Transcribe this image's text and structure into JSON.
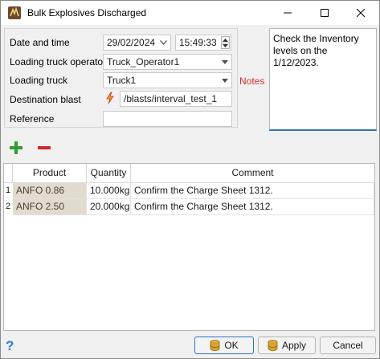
{
  "window": {
    "title": "Bulk Explosives Discharged"
  },
  "form": {
    "date_label": "Date and time",
    "date_value": "29/02/2024",
    "time_value": "15:49:33",
    "operator_label": "Loading truck operator",
    "operator_value": "Truck_Operator1",
    "truck_label": "Loading truck",
    "truck_value": "Truck1",
    "destination_label": "Destination blast",
    "destination_value": "/blasts/interval_test_1",
    "reference_label": "Reference",
    "reference_value": ""
  },
  "notes": {
    "label": "Notes",
    "text": "Check the Inventory levels on the 1/12/2023."
  },
  "toolbar": {
    "add_icon": "plus-icon",
    "remove_icon": "minus-icon"
  },
  "table": {
    "columns": [
      "Product",
      "Quantity",
      "Comment"
    ],
    "rows": [
      {
        "num": "1",
        "product": "ANFO 0.86",
        "quantity": "10.000kg",
        "comment": "Confirm the Charge Sheet 1312."
      },
      {
        "num": "2",
        "product": "ANFO 2.50",
        "quantity": "20.000kg",
        "comment": "Confirm the Charge Sheet 1312."
      }
    ]
  },
  "footer": {
    "help_label": "?",
    "ok_label": "OK",
    "apply_label": "Apply",
    "cancel_label": "Cancel"
  },
  "colors": {
    "notes_label": "#d32f2f",
    "add": "#2e9e2e",
    "remove": "#d62828",
    "product_cell": "#e1dbcf",
    "focus": "#2e72c5"
  }
}
